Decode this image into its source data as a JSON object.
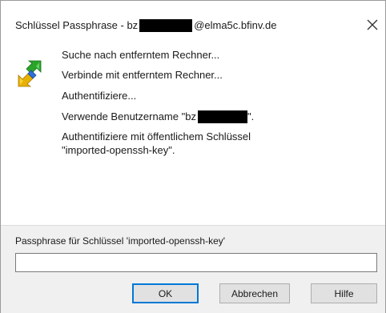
{
  "dialog": {
    "title_prefix": "Schlüssel Passphrase - bz",
    "title_suffix": "@elma5c.bfinv.de",
    "close_glyph": "✕"
  },
  "log": {
    "lines": [
      "Suche nach entferntem Rechner...",
      "Verbinde mit entferntem Rechner...",
      "Authentifiziere...",
      "Verwende Benutzername \"bz",
      "Authentifiziere mit öffentlichem Schlüssel",
      "\"imported-openssh-key\"."
    ],
    "username_suffix": "\"."
  },
  "passphrase": {
    "label": "Passphrase für Schlüssel 'imported-openssh-key'",
    "value": "",
    "placeholder": ""
  },
  "buttons": {
    "ok": "OK",
    "cancel": "Abbrechen",
    "help": "Hilfe"
  },
  "icons": {
    "app": "putty-key-arrows-icon",
    "close": "close-icon"
  },
  "colors": {
    "focus_border": "#0078d7",
    "panel_bg": "#f0f0f0",
    "button_bg": "#e1e1e1",
    "redaction": "#000000"
  }
}
